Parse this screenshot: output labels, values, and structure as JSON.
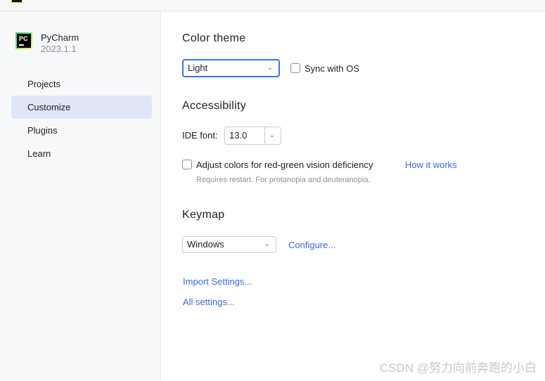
{
  "app": {
    "name": "PyCharm",
    "version": "2023.1.1"
  },
  "sidebar": {
    "items": [
      {
        "label": "Projects"
      },
      {
        "label": "Customize",
        "selected": true
      },
      {
        "label": "Plugins"
      },
      {
        "label": "Learn"
      }
    ]
  },
  "color_theme": {
    "heading": "Color theme",
    "value": "Light",
    "sync_label": "Sync with OS",
    "sync_checked": false
  },
  "accessibility": {
    "heading": "Accessibility",
    "font_label": "IDE font:",
    "font_value": "13.0",
    "adjust_label": "Adjust colors for red-green vision deficiency",
    "adjust_checked": false,
    "how_link": "How it works",
    "hint": "Requires restart. For protanopia and deuteranopia."
  },
  "keymap": {
    "heading": "Keymap",
    "value": "Windows",
    "configure": "Configure..."
  },
  "links": {
    "import": "Import Settings...",
    "all": "All settings..."
  },
  "watermark": "CSDN @努力向前奔跑的小白",
  "colors": {
    "accent": "#3d6ad3",
    "selected": "#dfe6f6"
  }
}
